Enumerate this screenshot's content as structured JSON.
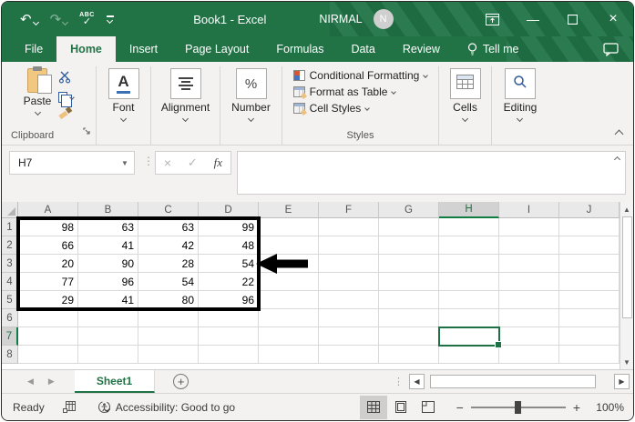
{
  "window": {
    "title": "Book1  -  Excel",
    "user": "NIRMAL",
    "avatar_initial": "N"
  },
  "quick_access": {
    "spelling_label": "ABC"
  },
  "tabs": [
    {
      "label": "File"
    },
    {
      "label": "Home",
      "active": true
    },
    {
      "label": "Insert"
    },
    {
      "label": "Page Layout"
    },
    {
      "label": "Formulas"
    },
    {
      "label": "Data"
    },
    {
      "label": "Review"
    },
    {
      "label": "Tell me",
      "icon": "lightbulb"
    }
  ],
  "ribbon": {
    "clipboard": {
      "paste_label": "Paste",
      "group_label": "Clipboard"
    },
    "font": {
      "label": "Font"
    },
    "alignment": {
      "label": "Alignment"
    },
    "number": {
      "label": "Number"
    },
    "styles": {
      "items": [
        "Conditional Formatting",
        "Format as Table",
        "Cell Styles"
      ],
      "group_label": "Styles"
    },
    "cells": {
      "label": "Cells"
    },
    "editing": {
      "label": "Editing"
    }
  },
  "formula_bar": {
    "name_box": "H7",
    "fx_label": "fx",
    "formula_value": ""
  },
  "grid": {
    "columns": [
      "A",
      "B",
      "C",
      "D",
      "E",
      "F",
      "G",
      "H",
      "I",
      "J"
    ],
    "rows": [
      "1",
      "2",
      "3",
      "4",
      "5",
      "6",
      "7",
      "8"
    ],
    "values": [
      [
        98,
        63,
        63,
        99
      ],
      [
        66,
        41,
        42,
        48
      ],
      [
        20,
        90,
        28,
        54
      ],
      [
        77,
        96,
        54,
        22
      ],
      [
        29,
        41,
        80,
        96
      ]
    ],
    "thick_border_range": "A1:D5",
    "arrow": {
      "row": "3",
      "from_column": "E"
    },
    "active_cell": "H7",
    "active_column": "H",
    "active_row": "7"
  },
  "sheet_bar": {
    "sheets": [
      {
        "name": "Sheet1",
        "active": true
      }
    ],
    "new_sheet_label": "+"
  },
  "status_bar": {
    "ready": "Ready",
    "accessibility": "Accessibility: Good to go",
    "zoom_level": "100%"
  },
  "colors": {
    "excel_green": "#217346",
    "selection_green": "#1e7145",
    "header_accent_green": "#107c41",
    "ribbon_bg": "#f3f2f1",
    "grid_line": "#d9d9d9",
    "annotation_black": "#000000",
    "icon_blue": "#2f5b9f"
  }
}
